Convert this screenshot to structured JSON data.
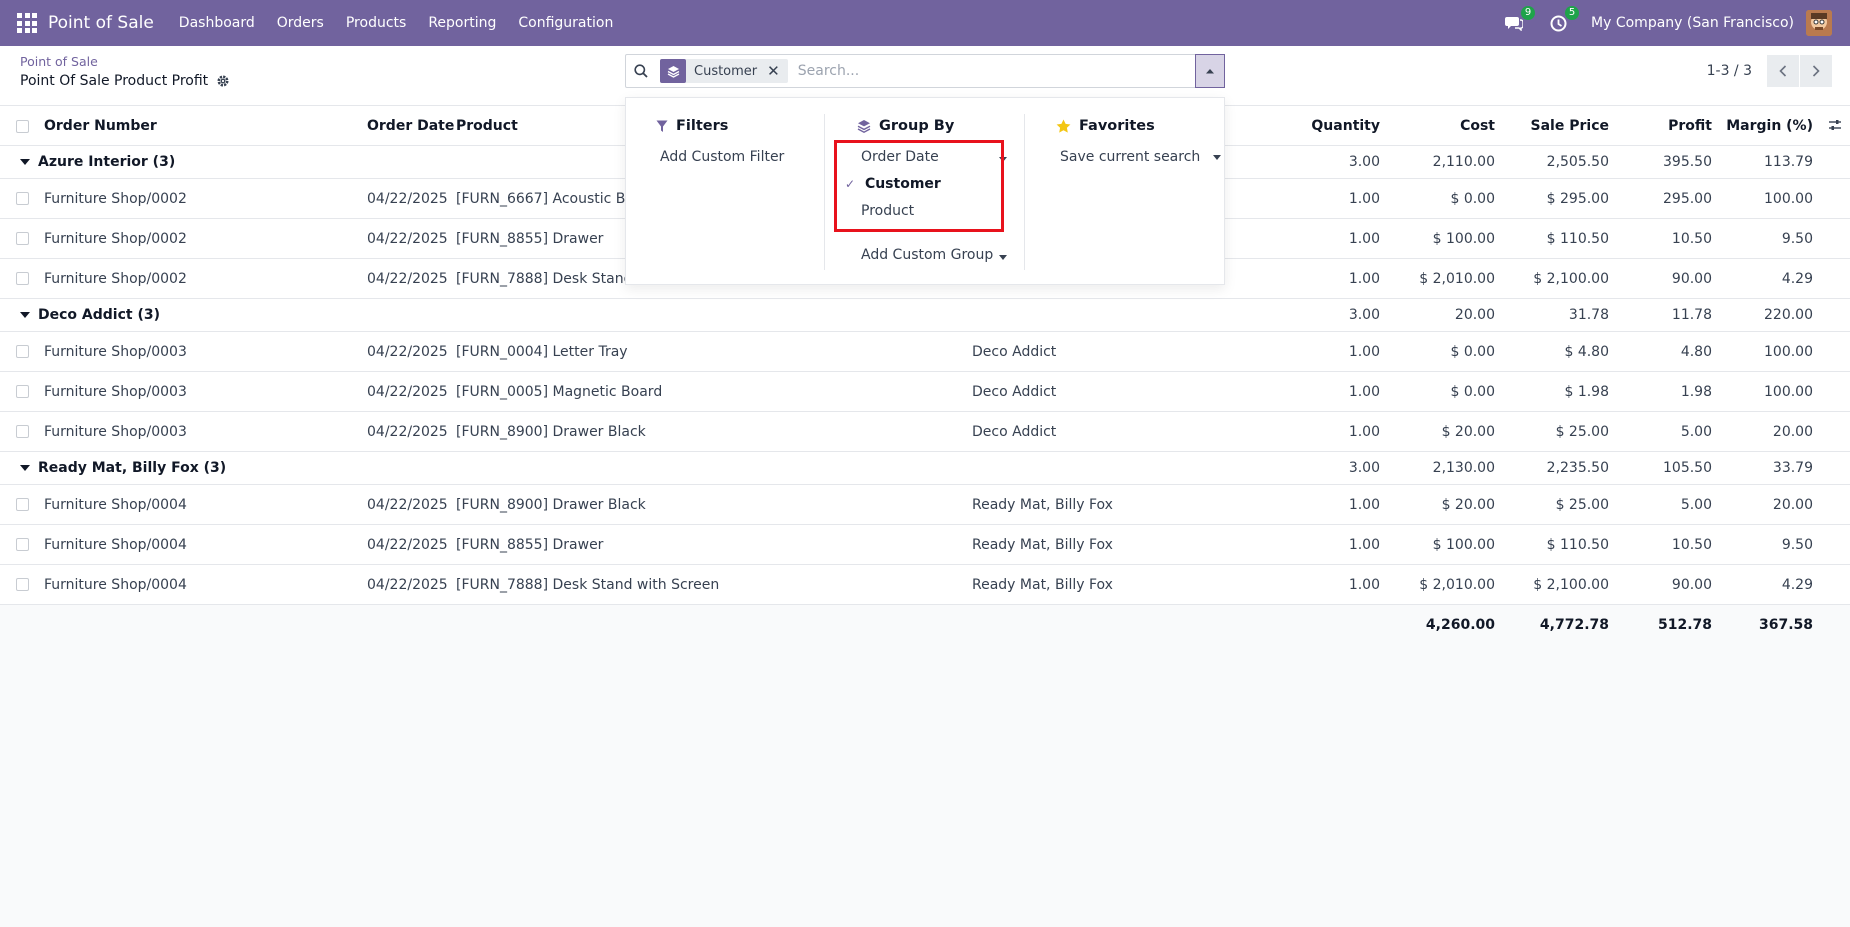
{
  "navbar": {
    "brand": "Point of Sale",
    "menu": [
      "Dashboard",
      "Orders",
      "Products",
      "Reporting",
      "Configuration"
    ],
    "messages_badge": "9",
    "activity_badge": "5",
    "company": "My Company (San Francisco)"
  },
  "breadcrumb": {
    "parent": "Point of Sale",
    "current": "Point Of Sale Product Profit"
  },
  "search": {
    "facet_label": "Customer",
    "facet_remove": "✕",
    "placeholder": "Search..."
  },
  "pager": {
    "value": "1-3 / 3"
  },
  "columns": {
    "order": "Order Number",
    "date": "Order Date",
    "product": "Product",
    "qty": "Quantity",
    "cost": "Cost",
    "sale": "Sale Price",
    "profit": "Profit",
    "margin": "Margin (%)"
  },
  "groups": [
    {
      "name": "Azure Interior (3)",
      "qty": "3.00",
      "cost": "2,110.00",
      "sale": "2,505.50",
      "profit": "395.50",
      "margin": "113.79",
      "rows": [
        {
          "order": "Furniture Shop/0002",
          "date": "04/22/2025",
          "product": "[FURN_6667] Acoustic Bloc",
          "customer": "",
          "qty": "1.00",
          "cost": "$ 0.00",
          "sale": "$ 295.00",
          "profit": "295.00",
          "margin": "100.00"
        },
        {
          "order": "Furniture Shop/0002",
          "date": "04/22/2025",
          "product": "[FURN_8855] Drawer",
          "customer": "",
          "qty": "1.00",
          "cost": "$ 100.00",
          "sale": "$ 110.50",
          "profit": "10.50",
          "margin": "9.50"
        },
        {
          "order": "Furniture Shop/0002",
          "date": "04/22/2025",
          "product": "[FURN_7888] Desk Stand w",
          "customer": "",
          "qty": "1.00",
          "cost": "$ 2,010.00",
          "sale": "$ 2,100.00",
          "profit": "90.00",
          "margin": "4.29"
        }
      ]
    },
    {
      "name": "Deco Addict (3)",
      "qty": "3.00",
      "cost": "20.00",
      "sale": "31.78",
      "profit": "11.78",
      "margin": "220.00",
      "rows": [
        {
          "order": "Furniture Shop/0003",
          "date": "04/22/2025",
          "product": "[FURN_0004] Letter Tray",
          "customer": "Deco Addict",
          "qty": "1.00",
          "cost": "$ 0.00",
          "sale": "$ 4.80",
          "profit": "4.80",
          "margin": "100.00"
        },
        {
          "order": "Furniture Shop/0003",
          "date": "04/22/2025",
          "product": "[FURN_0005] Magnetic Board",
          "customer": "Deco Addict",
          "qty": "1.00",
          "cost": "$ 0.00",
          "sale": "$ 1.98",
          "profit": "1.98",
          "margin": "100.00"
        },
        {
          "order": "Furniture Shop/0003",
          "date": "04/22/2025",
          "product": "[FURN_8900] Drawer Black",
          "customer": "Deco Addict",
          "qty": "1.00",
          "cost": "$ 20.00",
          "sale": "$ 25.00",
          "profit": "5.00",
          "margin": "20.00"
        }
      ]
    },
    {
      "name": "Ready Mat, Billy Fox (3)",
      "qty": "3.00",
      "cost": "2,130.00",
      "sale": "2,235.50",
      "profit": "105.50",
      "margin": "33.79",
      "rows": [
        {
          "order": "Furniture Shop/0004",
          "date": "04/22/2025",
          "product": "[FURN_8900] Drawer Black",
          "customer": "Ready Mat, Billy Fox",
          "qty": "1.00",
          "cost": "$ 20.00",
          "sale": "$ 25.00",
          "profit": "5.00",
          "margin": "20.00"
        },
        {
          "order": "Furniture Shop/0004",
          "date": "04/22/2025",
          "product": "[FURN_8855] Drawer",
          "customer": "Ready Mat, Billy Fox",
          "qty": "1.00",
          "cost": "$ 100.00",
          "sale": "$ 110.50",
          "profit": "10.50",
          "margin": "9.50"
        },
        {
          "order": "Furniture Shop/0004",
          "date": "04/22/2025",
          "product": "[FURN_7888] Desk Stand with Screen",
          "customer": "Ready Mat, Billy Fox",
          "qty": "1.00",
          "cost": "$ 2,010.00",
          "sale": "$ 2,100.00",
          "profit": "90.00",
          "margin": "4.29"
        }
      ]
    }
  ],
  "totals": {
    "cost": "4,260.00",
    "sale": "4,772.78",
    "profit": "512.78",
    "margin": "367.58"
  },
  "dropdown": {
    "filters_title": "Filters",
    "add_custom_filter": "Add Custom Filter",
    "groupby_title": "Group By",
    "groupby_items": [
      "Order Date",
      "Customer",
      "Product"
    ],
    "groupby_checked": "✓",
    "add_custom_group": "Add Custom Group",
    "favorites_title": "Favorites",
    "save_current_search": "Save current search"
  },
  "colors": {
    "navbar": "#71639e",
    "highlight": "#e8121c",
    "badge": "#1fa34a",
    "star": "#f3c614"
  },
  "icons": [
    "apps-grid-icon",
    "chat-icon",
    "clock-icon",
    "avatar",
    "gear-icon",
    "search-icon",
    "layers-icon",
    "caret-up-icon",
    "chevron-left-icon",
    "chevron-right-icon",
    "filter-icon",
    "star-icon",
    "column-options-icon"
  ]
}
